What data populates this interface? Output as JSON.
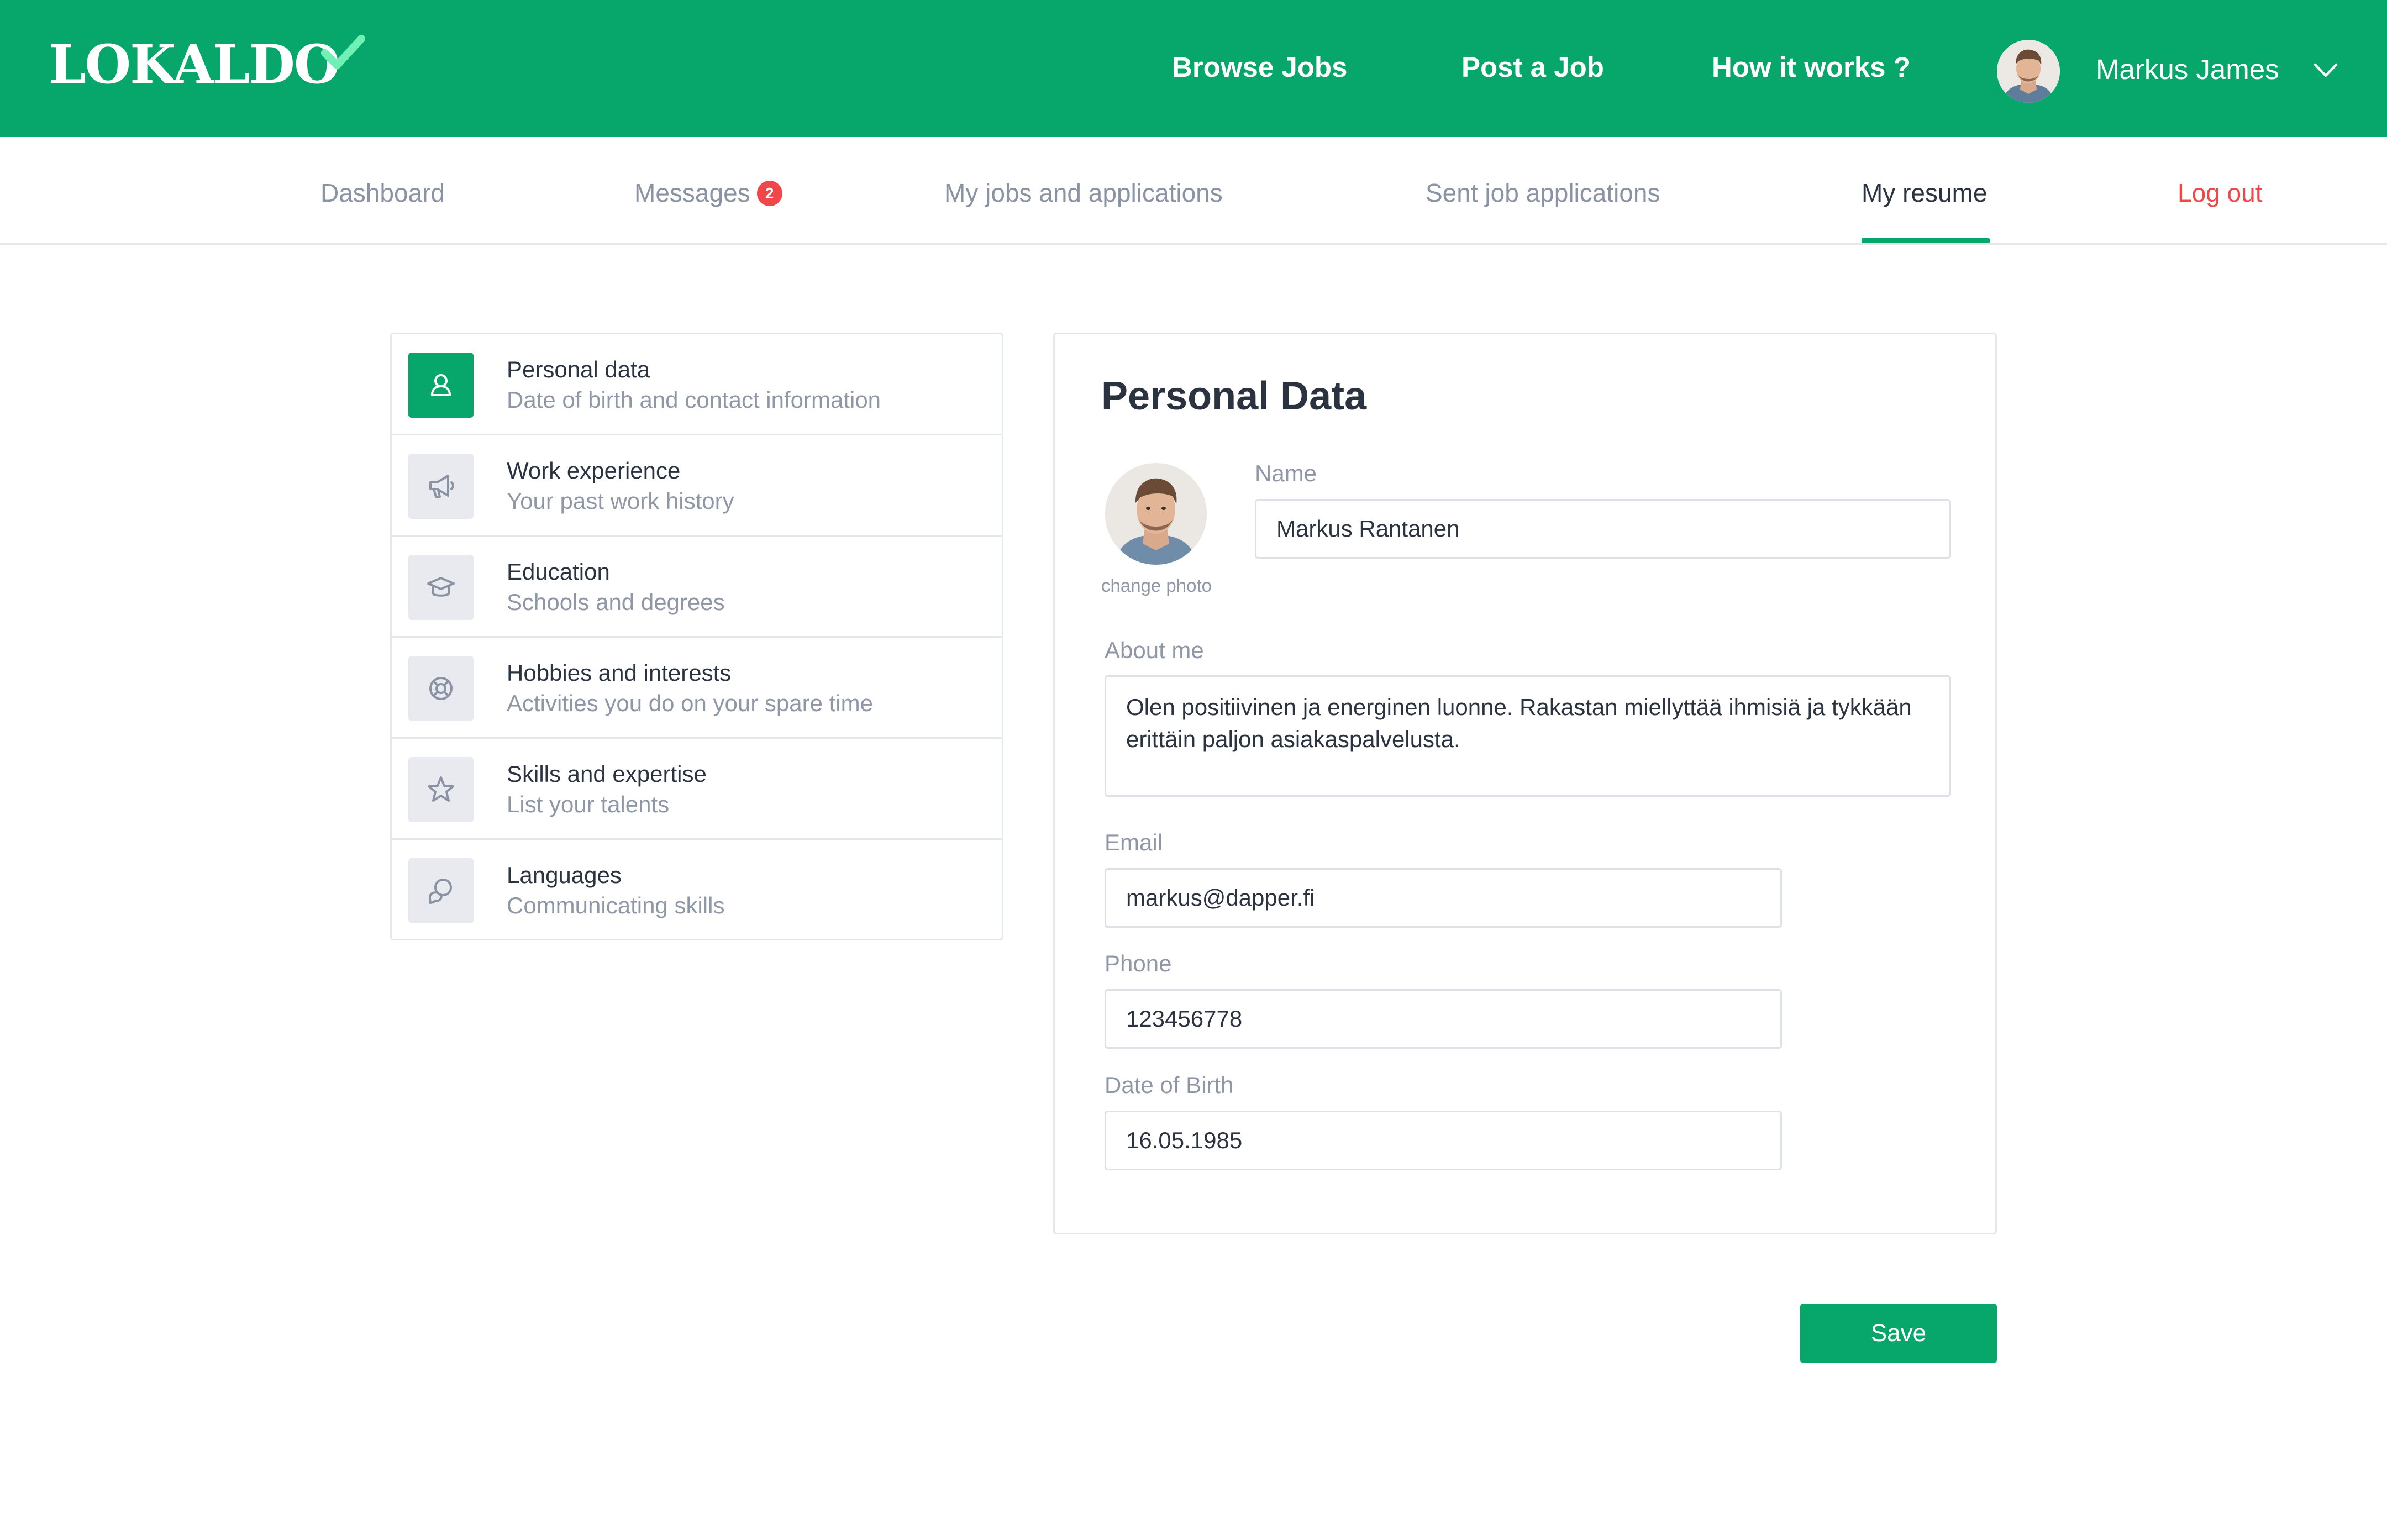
{
  "colors": {
    "brand": "#07a76b",
    "alert": "#f0474a",
    "muted": "#8a93a3",
    "text": "#2b3340"
  },
  "header": {
    "logo": "LOKALDO",
    "nav": [
      "Browse Jobs",
      "Post a Job",
      "How it works ?"
    ],
    "user_name": "Markus James",
    "user_menu_icon": "chevron-down-icon"
  },
  "subnav": {
    "tabs": {
      "dashboard": "Dashboard",
      "messages": "Messages",
      "messages_badge": "2",
      "my_jobs": "My jobs and applications",
      "sent": "Sent job applications",
      "resume": "My resume",
      "logout": "Log out"
    },
    "active_tab": "My resume"
  },
  "sidebar": {
    "items": [
      {
        "title": "Personal data",
        "subtitle": "Date of birth and contact information",
        "icon": "person-icon",
        "active": true
      },
      {
        "title": "Work experience",
        "subtitle": "Your past work history",
        "icon": "megaphone-icon",
        "active": false
      },
      {
        "title": "Education",
        "subtitle": "Schools and degrees",
        "icon": "graduation-cap-icon",
        "active": false
      },
      {
        "title": "Hobbies and interests",
        "subtitle": "Activities you do on your spare time",
        "icon": "lifebuoy-icon",
        "active": false
      },
      {
        "title": "Skills and expertise",
        "subtitle": "List your talents",
        "icon": "star-icon",
        "active": false
      },
      {
        "title": "Languages",
        "subtitle": "Communicating skills",
        "icon": "chat-bubbles-icon",
        "active": false
      }
    ]
  },
  "form": {
    "title": "Personal Data",
    "change_photo": "change photo",
    "name": {
      "label": "Name",
      "value": "Markus Rantanen"
    },
    "about": {
      "label": "About me",
      "value": "Olen positiivinen ja energinen luonne. Rakastan miellyttää ihmisiä ja tykkään erittäin paljon asiakaspalvelusta."
    },
    "email": {
      "label": "Email",
      "value": "markus@dapper.fi"
    },
    "phone": {
      "label": "Phone",
      "value": "123456778"
    },
    "dob": {
      "label": "Date of Birth",
      "value": "16.05.1985"
    },
    "save_label": "Save"
  }
}
